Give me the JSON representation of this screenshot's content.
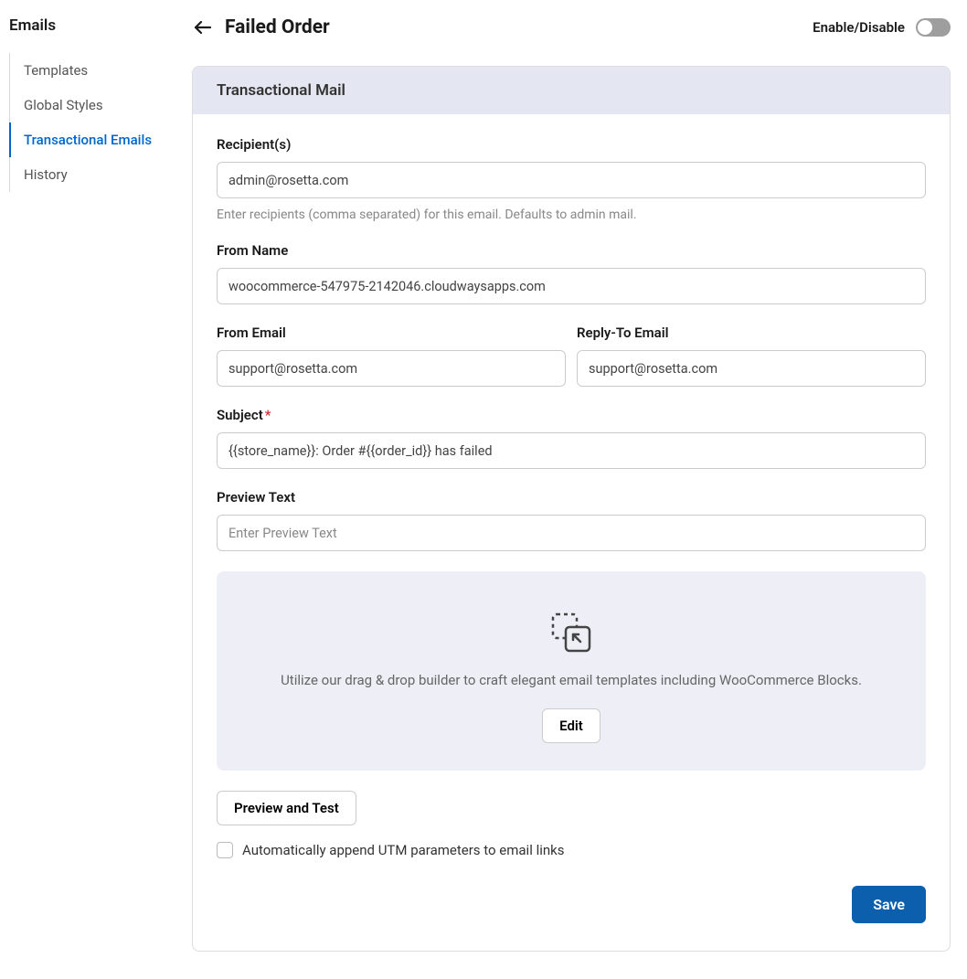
{
  "sidebar": {
    "title": "Emails",
    "items": [
      {
        "label": "Templates"
      },
      {
        "label": "Global Styles"
      },
      {
        "label": "Transactional Emails"
      },
      {
        "label": "History"
      }
    ]
  },
  "header": {
    "title": "Failed Order",
    "toggle_label": "Enable/Disable"
  },
  "card": {
    "title": "Transactional Mail",
    "recipients": {
      "label": "Recipient(s)",
      "value": "admin@rosetta.com",
      "helper": "Enter recipients (comma separated) for this email. Defaults to admin mail."
    },
    "from_name": {
      "label": "From Name",
      "value": "woocommerce-547975-2142046.cloudwaysapps.com"
    },
    "from_email": {
      "label": "From Email",
      "value": "support@rosetta.com"
    },
    "reply_to": {
      "label": "Reply-To Email",
      "value": "support@rosetta.com"
    },
    "subject": {
      "label": "Subject",
      "value": "{{store_name}}: Order #{{order_id}} has failed"
    },
    "preview_text": {
      "label": "Preview Text",
      "placeholder": "Enter Preview Text"
    },
    "builder": {
      "text": "Utilize our drag & drop builder to craft elegant email templates including WooCommerce Blocks.",
      "edit_label": "Edit"
    },
    "preview_test_label": "Preview and Test",
    "utm_label": "Automatically append UTM parameters to email links",
    "save_label": "Save"
  }
}
